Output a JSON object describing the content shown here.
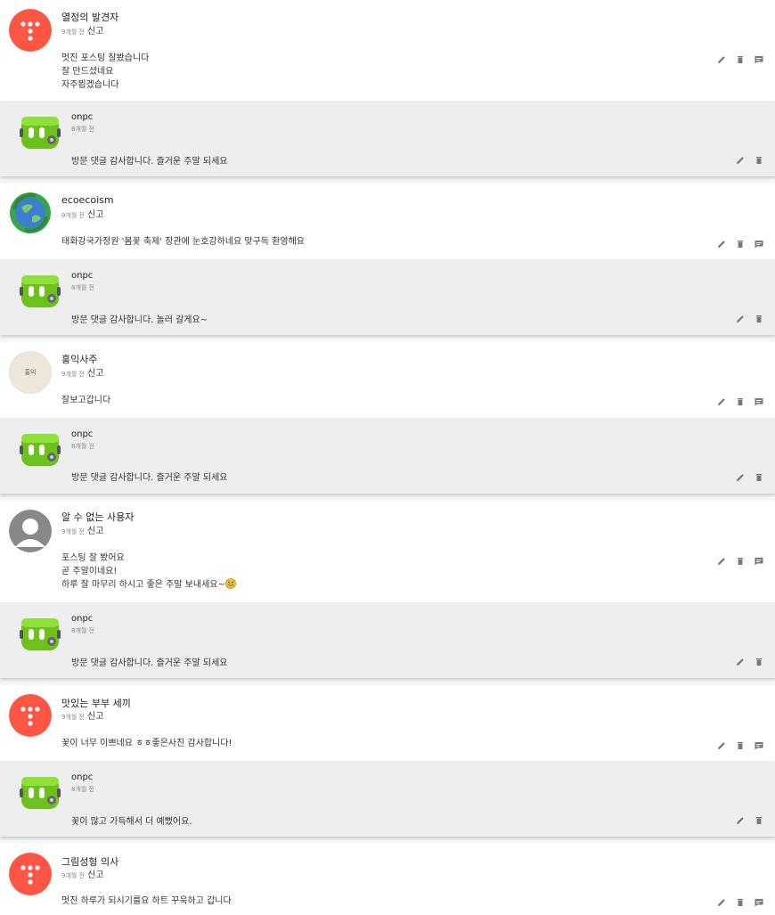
{
  "report_label": "신고",
  "threads": [
    {
      "author": "열정의 발견자",
      "time": "9개월 전",
      "lines": [
        "멋진 포스팅 잘봤습니다",
        "잘 만드셨네요",
        "자주뵙겠습니다"
      ],
      "reply": {
        "author": "onpc",
        "time": "8개월 전",
        "text": "방문 댓글 감사합니다. 즐거운 주말 되세요"
      }
    },
    {
      "author": "ecoecoism",
      "time": "9개월 전",
      "lines": [
        "태화강국가정원 '봄꽃 축제' 장관에 눈호강하네요 맞구독 환영해요"
      ],
      "reply": {
        "author": "onpc",
        "time": "8개월 전",
        "text": "방문 댓글 감사합니다. 놀러 갈게요~"
      }
    },
    {
      "author": "홍익사주",
      "time": "9개월 전",
      "lines": [
        "잘보고갑니다"
      ],
      "reply": {
        "author": "onpc",
        "time": "8개월 전",
        "text": "방문 댓글 감사합니다. 즐거운 주말 되세요"
      }
    },
    {
      "author": "알 수 없는 사용자",
      "time": "9개월 전",
      "lines": [
        "포스팅 잘 봤어요",
        "곧 주말이네요!",
        "하루 잘 마무리 하시고 좋은 주말 보내세요~"
      ],
      "reply": {
        "author": "onpc",
        "time": "8개월 전",
        "text": "방문 댓글 감사합니다. 즐거운 주말 되세요"
      }
    },
    {
      "author": "맛있는 부부 세끼",
      "time": "9개월 전",
      "lines": [
        "꽃이 너무 이쁘네요 ㅎㅎ좋은사진 감사합니다!"
      ],
      "reply": {
        "author": "onpc",
        "time": "8개월 전",
        "text": "꽃이 많고 가득해서 더 예뻤어요."
      }
    },
    {
      "author": "그림성형 의사",
      "time": "9개월 전",
      "lines": [
        "멋진 하루가 되시기를요 하트 꾸욱하고 갑니다"
      ]
    }
  ],
  "colors": {
    "accent": "#ff5544",
    "reply_bg": "#eeeeee",
    "icon": "#777777"
  },
  "icons": [
    "edit-icon",
    "trash-icon",
    "reply-icon"
  ],
  "avatar_badge_text": "홍익"
}
